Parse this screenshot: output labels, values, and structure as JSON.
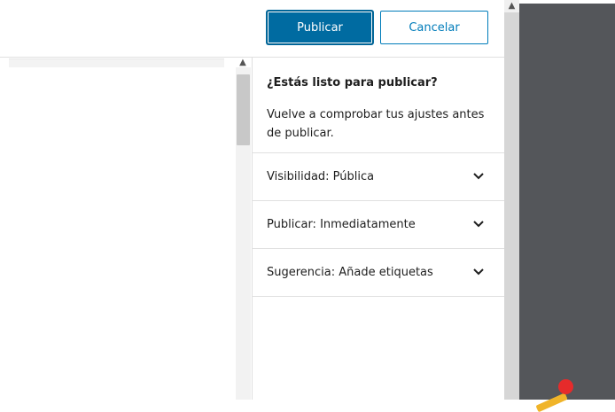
{
  "header": {
    "publish_label": "Publicar",
    "cancel_label": "Cancelar"
  },
  "prepublish": {
    "title": "¿Estás listo para publicar?",
    "description": "Vuelve a comprobar tus ajustes antes de publicar."
  },
  "sections": [
    {
      "label": "Visibilidad: Pública",
      "icon": "chevron-down-icon"
    },
    {
      "label": "Publicar: Inmediatamente",
      "icon": "chevron-down-icon"
    },
    {
      "label": "Sugerencia: Añade etiquetas",
      "icon": "chevron-down-icon"
    }
  ],
  "colors": {
    "primary": "#006ba1",
    "secondary_text": "#007cba",
    "dark_background": "#54565a",
    "accent_red": "#e62b2b",
    "accent_yellow": "#f0b429"
  }
}
